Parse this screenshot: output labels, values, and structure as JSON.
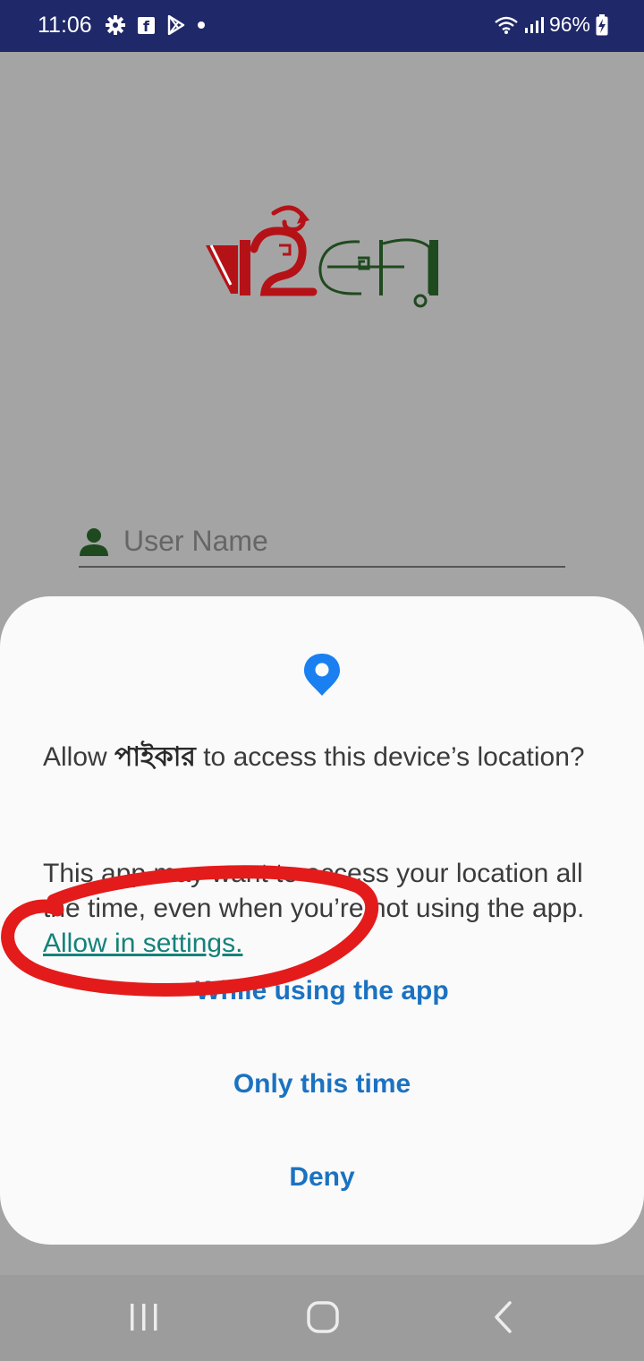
{
  "status_bar": {
    "time": "11:06",
    "icons": [
      "gear-icon",
      "facebook-icon",
      "play-store-icon",
      "dot-icon",
      "wifi-icon",
      "signal-icon",
      "battery-charging-icon"
    ],
    "battery_percent": "96%"
  },
  "app": {
    "logo_text": "পাইকার",
    "username_placeholder": "User Name"
  },
  "dialog": {
    "icon": "location-pin-icon",
    "title_prefix": "Allow ",
    "app_name": "পাইকার",
    "title_suffix": " to access this device’s location?",
    "body_text": "This app may want to access your location all the time, even when you’re not using the app. ",
    "settings_link": "Allow in settings.",
    "options": [
      "While using the app",
      "Only this time",
      "Deny"
    ]
  },
  "nav_bar": {
    "icons": [
      "recents-icon",
      "home-icon",
      "back-icon"
    ]
  },
  "colors": {
    "status_bar": "#1f2868",
    "dialog_button": "#1b72c1",
    "link": "#14827a",
    "annotation": "#e41b1b",
    "pin": "#1a7ff0"
  }
}
